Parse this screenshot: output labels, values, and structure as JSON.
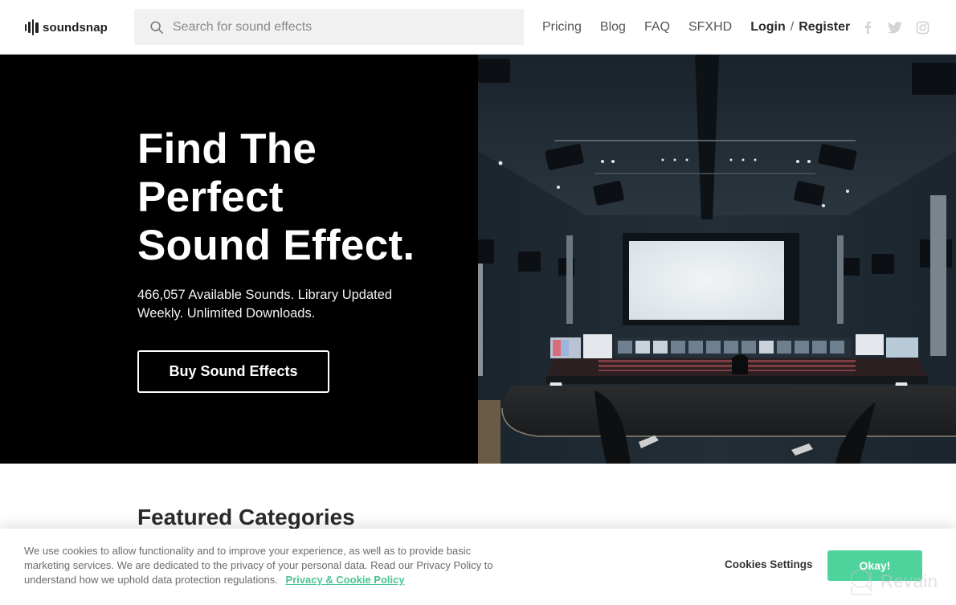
{
  "header": {
    "logo_text": "soundsnap",
    "search": {
      "placeholder": "Search for sound effects",
      "value": ""
    },
    "nav": [
      {
        "label": "Pricing"
      },
      {
        "label": "Blog"
      },
      {
        "label": "FAQ"
      },
      {
        "label": "SFXHD"
      }
    ],
    "auth": {
      "login": "Login",
      "separator": "/",
      "register": "Register"
    },
    "social": [
      {
        "icon": "facebook-icon"
      },
      {
        "icon": "twitter-icon"
      },
      {
        "icon": "instagram-icon"
      }
    ]
  },
  "hero": {
    "title_lines": [
      "Find The",
      "Perfect",
      "Sound Effect."
    ],
    "subtitle": "466,057 Available Sounds. Library Updated Weekly. Unlimited Downloads.",
    "cta_label": "Buy Sound Effects",
    "image_description": "Dark cinema mixing studio with large screen and mixing console"
  },
  "featured": {
    "heading": "Featured Categories"
  },
  "cookie_banner": {
    "text": "We use cookies to allow functionality and to improve your experience, as well as to provide basic marketing services. We are dedicated to the privacy of your personal data. Read our Privacy Policy to understand how we uphold data protection regulations.",
    "policy_link": "Privacy & Cookie Policy",
    "settings_label": "Cookies Settings",
    "ok_label": "Okay!",
    "accent_color": "#4fd39d"
  },
  "watermark": {
    "text": "Revain"
  }
}
